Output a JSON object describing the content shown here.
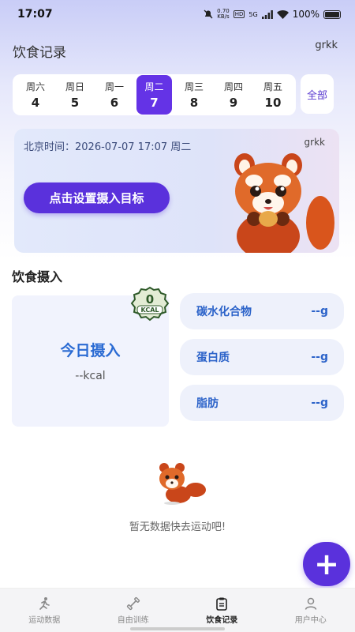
{
  "status_bar": {
    "time": "17:07",
    "speed": "0.70",
    "speed_unit": "KB/s",
    "hd": "HD",
    "network": "5G",
    "battery": "100%"
  },
  "header": {
    "title": "饮食记录",
    "username": "grkk"
  },
  "week": {
    "days": [
      {
        "weekday": "周六",
        "date": "4"
      },
      {
        "weekday": "周日",
        "date": "5"
      },
      {
        "weekday": "周一",
        "date": "6"
      },
      {
        "weekday": "周二",
        "date": "7"
      },
      {
        "weekday": "周三",
        "date": "8"
      },
      {
        "weekday": "周四",
        "date": "9"
      },
      {
        "weekday": "周五",
        "date": "10"
      }
    ],
    "selected_index": 3,
    "all_label": "全部"
  },
  "hero": {
    "time_text": "北京时间：2026-07-07 17:07 周二",
    "username": "grkk",
    "goal_button": "点击设置摄入目标"
  },
  "intake": {
    "section_title": "饮食摄入",
    "today_label": "今日摄入",
    "today_value": "--kcal",
    "badge_number": "0",
    "badge_unit": "KCAL",
    "nutrients": [
      {
        "name": "碳水化合物",
        "value": "--g"
      },
      {
        "name": "蛋白质",
        "value": "--g"
      },
      {
        "name": "脂肪",
        "value": "--g"
      }
    ]
  },
  "empty_state": {
    "text": "暂无数据快去运动吧!"
  },
  "fab": {
    "label": "+"
  },
  "bottom_nav": {
    "items": [
      {
        "label": "运动数据",
        "icon": "running-icon"
      },
      {
        "label": "自由训练",
        "icon": "dumbbell-icon"
      },
      {
        "label": "饮食记录",
        "icon": "clipboard-icon"
      },
      {
        "label": "用户中心",
        "icon": "user-icon"
      }
    ],
    "active_index": 2
  },
  "colors": {
    "accent": "#5a31dc",
    "nutrient_text": "#2c63c9",
    "intake_text": "#2b6bd3"
  }
}
